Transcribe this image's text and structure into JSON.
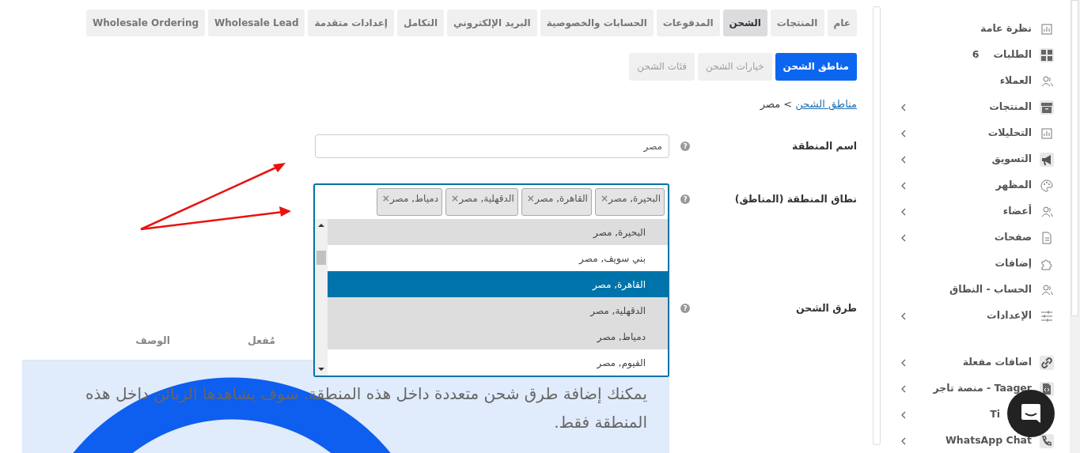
{
  "tabs": [
    {
      "label": "عام",
      "selected": false
    },
    {
      "label": "المنتجات",
      "selected": false
    },
    {
      "label": "الشحن",
      "selected": true
    },
    {
      "label": "المدفوعات",
      "selected": false
    },
    {
      "label": "الحسابات والخصوصية",
      "selected": false
    },
    {
      "label": "البريد الإلكتروني",
      "selected": false
    },
    {
      "label": "التكامل",
      "selected": false
    },
    {
      "label": "إعدادات متقدمة",
      "selected": false
    },
    {
      "label": "Wholesale Lead",
      "selected": false
    },
    {
      "label": "Wholesale Ordering",
      "selected": false
    }
  ],
  "subtabs": [
    {
      "label": "مناطق الشحن",
      "selected": true
    },
    {
      "label": "خيارات الشحن",
      "selected": false
    },
    {
      "label": "فئات الشحن",
      "selected": false
    }
  ],
  "breadcrumb": {
    "link": "مناطق الشحن",
    "separator": ">",
    "current": "مصر"
  },
  "zone_name": {
    "label": "اسم المنطقة",
    "help": "?",
    "value": "مصر"
  },
  "zone_regions": {
    "label": "نطاق المنطقة (المناطق)",
    "help": "?",
    "tags": [
      {
        "label": "البحيرة, مصر",
        "remove": "×"
      },
      {
        "label": "القاهرة, مصر",
        "remove": "×"
      },
      {
        "label": "الدقهلية, مصر",
        "remove": "×"
      },
      {
        "label": "دمياط, مصر",
        "remove": "×"
      }
    ],
    "options": [
      {
        "label": "البحيرة, مصر",
        "selected": true,
        "highlighted": false
      },
      {
        "label": "بني سويف, مصر",
        "selected": false,
        "highlighted": false
      },
      {
        "label": "القاهرة, مصر",
        "selected": true,
        "highlighted": true
      },
      {
        "label": "الدقهلية, مصر",
        "selected": true,
        "highlighted": false
      },
      {
        "label": "دمياط, مصر",
        "selected": true,
        "highlighted": false
      },
      {
        "label": "الفيوم, مصر",
        "selected": false,
        "highlighted": false
      }
    ]
  },
  "shipping_methods": {
    "label": "طرق الشحن",
    "help": "?",
    "columns": [
      "مُفعل",
      "الوصف"
    ],
    "info": "يمكنك إضافة طرق شحن متعددة داخل هذه المنطقة. سوف يشاهدها الزبائن داخل هذه المنطقة فقط."
  },
  "sidebar": {
    "items": [
      {
        "label": "نظرة عامة",
        "expandable": false
      },
      {
        "label": "الطلبات",
        "count": "6",
        "expandable": false
      },
      {
        "label": "العملاء",
        "expandable": false
      },
      {
        "label": "المنتجات",
        "expandable": true
      },
      {
        "label": "التحليلات",
        "expandable": true
      },
      {
        "label": "التسويق",
        "expandable": true
      },
      {
        "label": "المظهر",
        "expandable": true
      },
      {
        "label": "أعضاء",
        "expandable": true
      },
      {
        "label": "صفحات",
        "expandable": true
      },
      {
        "label": "إضافات",
        "expandable": false
      },
      {
        "label": "الحساب - النطاق",
        "expandable": false
      },
      {
        "label": "الإعدادات",
        "expandable": true
      }
    ],
    "extra_items": [
      {
        "label": "اضافات مفعلة",
        "expandable": true
      },
      {
        "label": "Taager - منصة تاجر",
        "expandable": true
      },
      {
        "label": "Ti",
        "expandable": true
      },
      {
        "label": "WhatsApp Chat",
        "expandable": true
      }
    ]
  }
}
